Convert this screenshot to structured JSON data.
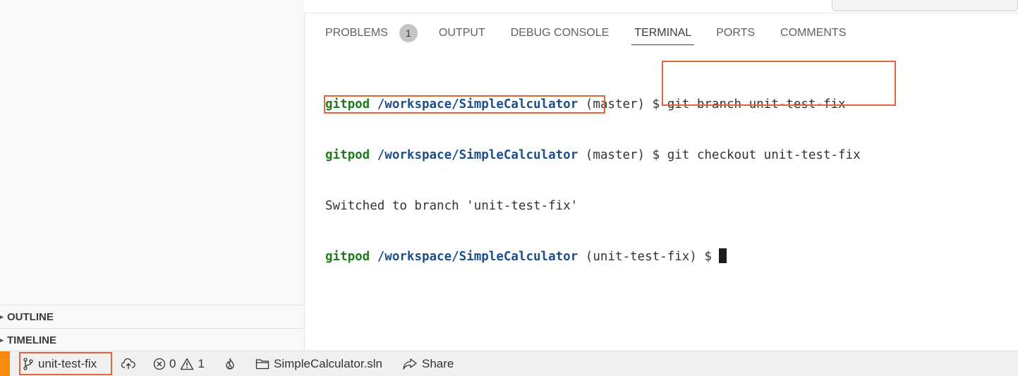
{
  "sidebar": {
    "outline_label": "OUTLINE",
    "timeline_label": "TIMELINE"
  },
  "panel": {
    "tabs": [
      {
        "label": "PROBLEMS",
        "badge": "1"
      },
      {
        "label": "OUTPUT"
      },
      {
        "label": "DEBUG CONSOLE"
      },
      {
        "label": "TERMINAL"
      },
      {
        "label": "PORTS"
      },
      {
        "label": "COMMENTS"
      }
    ],
    "active_tab": "TERMINAL"
  },
  "terminal": {
    "lines": [
      {
        "user": "gitpod",
        "path": "/workspace/SimpleCalculator",
        "branch": "(master)",
        "cmd": "$ git branch unit-test-fix"
      },
      {
        "user": "gitpod",
        "path": "/workspace/SimpleCalculator",
        "branch": "(master)",
        "cmd": "$ git checkout unit-test-fix"
      },
      {
        "output": "Switched to branch 'unit-test-fix'"
      },
      {
        "user": "gitpod",
        "path": "/workspace/SimpleCalculator",
        "branch": "(unit-test-fix)",
        "cmd": "$ "
      }
    ],
    "colors": {
      "user": "#1f7a1f",
      "path": "#1b4f8c",
      "highlight": "#e0653a"
    }
  },
  "statusbar": {
    "branch": "unit-test-fix",
    "errors": "0",
    "warnings": "1",
    "solution": "SimpleCalculator.sln",
    "share": "Share",
    "remote_color": "#f88a0e"
  }
}
